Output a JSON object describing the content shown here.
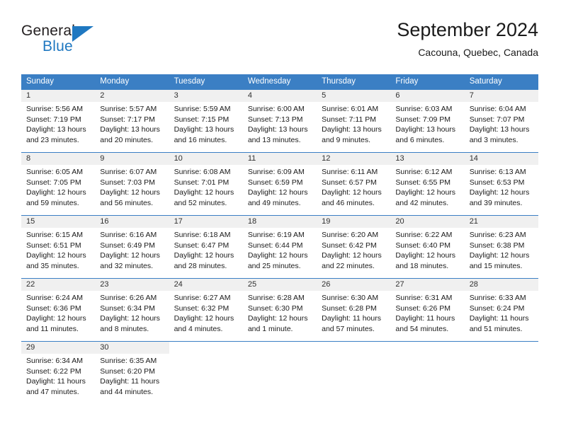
{
  "branding": {
    "name_part1": "General",
    "name_part2": "Blue",
    "logo_icon": "triangle-logo-icon"
  },
  "header": {
    "title": "September 2024",
    "location": "Cacouna, Quebec, Canada"
  },
  "calendar": {
    "weekday_headers": [
      "Sunday",
      "Monday",
      "Tuesday",
      "Wednesday",
      "Thursday",
      "Friday",
      "Saturday"
    ],
    "accent_color": "#3b7fc4",
    "daynum_band_color": "#f0f0f0",
    "weeks": [
      [
        {
          "day": "1",
          "sunrise": "Sunrise: 5:56 AM",
          "sunset": "Sunset: 7:19 PM",
          "daylight_line1": "Daylight: 13 hours",
          "daylight_line2": "and 23 minutes."
        },
        {
          "day": "2",
          "sunrise": "Sunrise: 5:57 AM",
          "sunset": "Sunset: 7:17 PM",
          "daylight_line1": "Daylight: 13 hours",
          "daylight_line2": "and 20 minutes."
        },
        {
          "day": "3",
          "sunrise": "Sunrise: 5:59 AM",
          "sunset": "Sunset: 7:15 PM",
          "daylight_line1": "Daylight: 13 hours",
          "daylight_line2": "and 16 minutes."
        },
        {
          "day": "4",
          "sunrise": "Sunrise: 6:00 AM",
          "sunset": "Sunset: 7:13 PM",
          "daylight_line1": "Daylight: 13 hours",
          "daylight_line2": "and 13 minutes."
        },
        {
          "day": "5",
          "sunrise": "Sunrise: 6:01 AM",
          "sunset": "Sunset: 7:11 PM",
          "daylight_line1": "Daylight: 13 hours",
          "daylight_line2": "and 9 minutes."
        },
        {
          "day": "6",
          "sunrise": "Sunrise: 6:03 AM",
          "sunset": "Sunset: 7:09 PM",
          "daylight_line1": "Daylight: 13 hours",
          "daylight_line2": "and 6 minutes."
        },
        {
          "day": "7",
          "sunrise": "Sunrise: 6:04 AM",
          "sunset": "Sunset: 7:07 PM",
          "daylight_line1": "Daylight: 13 hours",
          "daylight_line2": "and 3 minutes."
        }
      ],
      [
        {
          "day": "8",
          "sunrise": "Sunrise: 6:05 AM",
          "sunset": "Sunset: 7:05 PM",
          "daylight_line1": "Daylight: 12 hours",
          "daylight_line2": "and 59 minutes."
        },
        {
          "day": "9",
          "sunrise": "Sunrise: 6:07 AM",
          "sunset": "Sunset: 7:03 PM",
          "daylight_line1": "Daylight: 12 hours",
          "daylight_line2": "and 56 minutes."
        },
        {
          "day": "10",
          "sunrise": "Sunrise: 6:08 AM",
          "sunset": "Sunset: 7:01 PM",
          "daylight_line1": "Daylight: 12 hours",
          "daylight_line2": "and 52 minutes."
        },
        {
          "day": "11",
          "sunrise": "Sunrise: 6:09 AM",
          "sunset": "Sunset: 6:59 PM",
          "daylight_line1": "Daylight: 12 hours",
          "daylight_line2": "and 49 minutes."
        },
        {
          "day": "12",
          "sunrise": "Sunrise: 6:11 AM",
          "sunset": "Sunset: 6:57 PM",
          "daylight_line1": "Daylight: 12 hours",
          "daylight_line2": "and 46 minutes."
        },
        {
          "day": "13",
          "sunrise": "Sunrise: 6:12 AM",
          "sunset": "Sunset: 6:55 PM",
          "daylight_line1": "Daylight: 12 hours",
          "daylight_line2": "and 42 minutes."
        },
        {
          "day": "14",
          "sunrise": "Sunrise: 6:13 AM",
          "sunset": "Sunset: 6:53 PM",
          "daylight_line1": "Daylight: 12 hours",
          "daylight_line2": "and 39 minutes."
        }
      ],
      [
        {
          "day": "15",
          "sunrise": "Sunrise: 6:15 AM",
          "sunset": "Sunset: 6:51 PM",
          "daylight_line1": "Daylight: 12 hours",
          "daylight_line2": "and 35 minutes."
        },
        {
          "day": "16",
          "sunrise": "Sunrise: 6:16 AM",
          "sunset": "Sunset: 6:49 PM",
          "daylight_line1": "Daylight: 12 hours",
          "daylight_line2": "and 32 minutes."
        },
        {
          "day": "17",
          "sunrise": "Sunrise: 6:18 AM",
          "sunset": "Sunset: 6:47 PM",
          "daylight_line1": "Daylight: 12 hours",
          "daylight_line2": "and 28 minutes."
        },
        {
          "day": "18",
          "sunrise": "Sunrise: 6:19 AM",
          "sunset": "Sunset: 6:44 PM",
          "daylight_line1": "Daylight: 12 hours",
          "daylight_line2": "and 25 minutes."
        },
        {
          "day": "19",
          "sunrise": "Sunrise: 6:20 AM",
          "sunset": "Sunset: 6:42 PM",
          "daylight_line1": "Daylight: 12 hours",
          "daylight_line2": "and 22 minutes."
        },
        {
          "day": "20",
          "sunrise": "Sunrise: 6:22 AM",
          "sunset": "Sunset: 6:40 PM",
          "daylight_line1": "Daylight: 12 hours",
          "daylight_line2": "and 18 minutes."
        },
        {
          "day": "21",
          "sunrise": "Sunrise: 6:23 AM",
          "sunset": "Sunset: 6:38 PM",
          "daylight_line1": "Daylight: 12 hours",
          "daylight_line2": "and 15 minutes."
        }
      ],
      [
        {
          "day": "22",
          "sunrise": "Sunrise: 6:24 AM",
          "sunset": "Sunset: 6:36 PM",
          "daylight_line1": "Daylight: 12 hours",
          "daylight_line2": "and 11 minutes."
        },
        {
          "day": "23",
          "sunrise": "Sunrise: 6:26 AM",
          "sunset": "Sunset: 6:34 PM",
          "daylight_line1": "Daylight: 12 hours",
          "daylight_line2": "and 8 minutes."
        },
        {
          "day": "24",
          "sunrise": "Sunrise: 6:27 AM",
          "sunset": "Sunset: 6:32 PM",
          "daylight_line1": "Daylight: 12 hours",
          "daylight_line2": "and 4 minutes."
        },
        {
          "day": "25",
          "sunrise": "Sunrise: 6:28 AM",
          "sunset": "Sunset: 6:30 PM",
          "daylight_line1": "Daylight: 12 hours",
          "daylight_line2": "and 1 minute."
        },
        {
          "day": "26",
          "sunrise": "Sunrise: 6:30 AM",
          "sunset": "Sunset: 6:28 PM",
          "daylight_line1": "Daylight: 11 hours",
          "daylight_line2": "and 57 minutes."
        },
        {
          "day": "27",
          "sunrise": "Sunrise: 6:31 AM",
          "sunset": "Sunset: 6:26 PM",
          "daylight_line1": "Daylight: 11 hours",
          "daylight_line2": "and 54 minutes."
        },
        {
          "day": "28",
          "sunrise": "Sunrise: 6:33 AM",
          "sunset": "Sunset: 6:24 PM",
          "daylight_line1": "Daylight: 11 hours",
          "daylight_line2": "and 51 minutes."
        }
      ],
      [
        {
          "day": "29",
          "sunrise": "Sunrise: 6:34 AM",
          "sunset": "Sunset: 6:22 PM",
          "daylight_line1": "Daylight: 11 hours",
          "daylight_line2": "and 47 minutes."
        },
        {
          "day": "30",
          "sunrise": "Sunrise: 6:35 AM",
          "sunset": "Sunset: 6:20 PM",
          "daylight_line1": "Daylight: 11 hours",
          "daylight_line2": "and 44 minutes."
        },
        {
          "day": "",
          "sunrise": "",
          "sunset": "",
          "daylight_line1": "",
          "daylight_line2": ""
        },
        {
          "day": "",
          "sunrise": "",
          "sunset": "",
          "daylight_line1": "",
          "daylight_line2": ""
        },
        {
          "day": "",
          "sunrise": "",
          "sunset": "",
          "daylight_line1": "",
          "daylight_line2": ""
        },
        {
          "day": "",
          "sunrise": "",
          "sunset": "",
          "daylight_line1": "",
          "daylight_line2": ""
        },
        {
          "day": "",
          "sunrise": "",
          "sunset": "",
          "daylight_line1": "",
          "daylight_line2": ""
        }
      ]
    ]
  }
}
